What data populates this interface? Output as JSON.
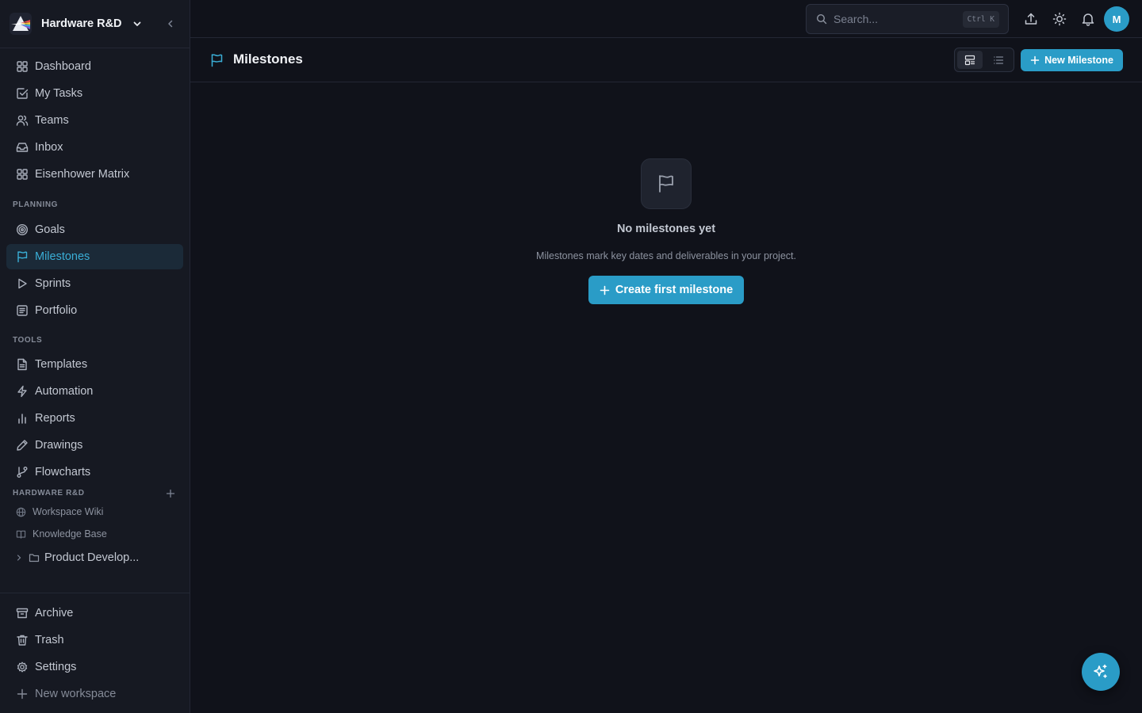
{
  "workspace": {
    "name": "Hardware R&D"
  },
  "sidebar": {
    "main_items": [
      {
        "label": "Dashboard",
        "icon": "grid-icon"
      },
      {
        "label": "My Tasks",
        "icon": "checkbox-icon"
      },
      {
        "label": "Teams",
        "icon": "users-icon"
      },
      {
        "label": "Inbox",
        "icon": "inbox-icon"
      },
      {
        "label": "Eisenhower Matrix",
        "icon": "grid-icon"
      }
    ],
    "planning_label": "PLANNING",
    "planning_items": [
      {
        "label": "Goals",
        "icon": "target-icon"
      },
      {
        "label": "Milestones",
        "icon": "flag-icon",
        "active": true
      },
      {
        "label": "Sprints",
        "icon": "play-icon"
      },
      {
        "label": "Portfolio",
        "icon": "portfolio-icon"
      }
    ],
    "tools_label": "TOOLS",
    "tools_items": [
      {
        "label": "Templates",
        "icon": "file-icon"
      },
      {
        "label": "Automation",
        "icon": "bolt-icon"
      },
      {
        "label": "Reports",
        "icon": "bar-chart-icon"
      },
      {
        "label": "Drawings",
        "icon": "pen-icon"
      },
      {
        "label": "Flowcharts",
        "icon": "branch-icon"
      }
    ],
    "workspace_section_label": "HARDWARE R&D",
    "workspace_links": [
      {
        "label": "Workspace Wiki",
        "icon": "globe-icon"
      },
      {
        "label": "Knowledge Base",
        "icon": "book-icon"
      }
    ],
    "folder": {
      "label": "Product Develop...",
      "icon": "folder-icon"
    },
    "bottom_items": [
      {
        "label": "Archive",
        "icon": "archive-icon"
      },
      {
        "label": "Trash",
        "icon": "trash-icon"
      },
      {
        "label": "Settings",
        "icon": "gear-icon"
      }
    ],
    "new_workspace_label": "New workspace"
  },
  "topbar": {
    "search_placeholder": "Search...",
    "search_shortcut": "Ctrl K",
    "avatar_initial": "M"
  },
  "page": {
    "title": "Milestones",
    "new_button_label": "New Milestone"
  },
  "empty_state": {
    "title": "No milestones yet",
    "description": "Milestones mark key dates and deliverables in your project.",
    "button_label": "Create first milestone"
  },
  "colors": {
    "accent": "#2a9cc7",
    "background": "#10121a",
    "sidebar": "#161922"
  }
}
